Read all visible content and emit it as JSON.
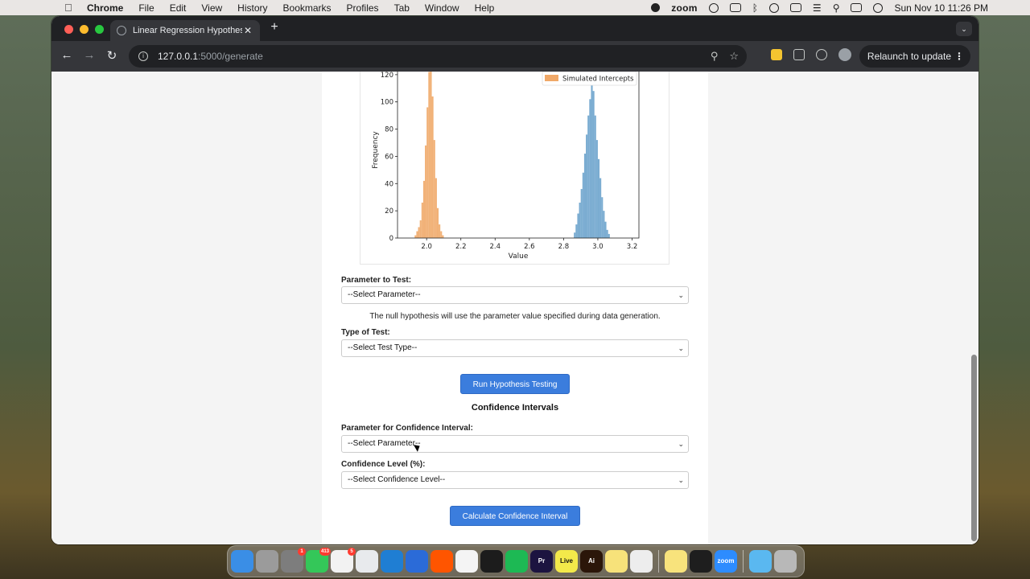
{
  "menubar": {
    "app_name": "Chrome",
    "items": [
      "File",
      "Edit",
      "View",
      "History",
      "Bookmarks",
      "Profiles",
      "Tab",
      "Window",
      "Help"
    ],
    "zoom_label": "zoom",
    "datetime": "Sun Nov 10  11:26 PM"
  },
  "browser": {
    "tab_title": "Linear Regression Hypothesis",
    "tab_close": "✕",
    "new_tab": "+",
    "url_host": "127.0.0.1",
    "url_path": ":5000/generate",
    "relaunch_label": "Relaunch to update"
  },
  "chart_data": {
    "type": "histogram",
    "xlabel": "Value",
    "ylabel": "Frequency",
    "xlim": [
      1.83,
      3.24
    ],
    "ylim": [
      0,
      127
    ],
    "xticks": [
      "2.0",
      "2.2",
      "2.4",
      "2.6",
      "2.8",
      "3.0",
      "3.2"
    ],
    "yticks": [
      "0",
      "20",
      "40",
      "60",
      "80",
      "100",
      "120"
    ],
    "legend": {
      "label": "Simulated Intercepts",
      "placement": "top-right"
    },
    "series": [
      {
        "name": "Simulated Intercepts",
        "color": "#f0a868",
        "bin_start": 1.93,
        "bin_width": 0.01,
        "values": [
          2,
          5,
          8,
          13,
          26,
          42,
          68,
          96,
          122,
          127,
          104,
          72,
          44,
          22,
          10,
          5,
          2
        ]
      },
      {
        "name": "",
        "color": "#6ba3cc",
        "bin_start": 2.86,
        "bin_width": 0.01,
        "values": [
          4,
          10,
          18,
          26,
          36,
          48,
          62,
          76,
          90,
          102,
          116,
          108,
          90,
          72,
          58,
          44,
          30,
          20,
          12,
          6,
          3
        ]
      }
    ]
  },
  "form": {
    "param_label": "Parameter to Test:",
    "param_select": "--Select Parameter--",
    "null_note": "The null hypothesis will use the parameter value specified during data generation.",
    "test_label": "Type of Test:",
    "test_select": "--Select Test Type--",
    "run_button": "Run Hypothesis Testing",
    "ci_title": "Confidence Intervals",
    "ci_param_label": "Parameter for Confidence Interval:",
    "ci_param_select": "--Select Parameter--",
    "ci_level_label": "Confidence Level (%):",
    "ci_level_select": "--Select Confidence Level--",
    "ci_button": "Calculate Confidence Interval"
  },
  "dock": {
    "apps": [
      {
        "icon": "finder-icon",
        "color": "#3a8ee6"
      },
      {
        "icon": "launchpad-icon",
        "color": "#9b9b9b"
      },
      {
        "icon": "system-settings-icon",
        "color": "#7d7d7d",
        "badge": "1"
      },
      {
        "icon": "messages-icon",
        "color": "#34c759",
        "badge": "413"
      },
      {
        "icon": "reminders-icon",
        "color": "#f2f2f2",
        "badge": "5"
      },
      {
        "icon": "chrome-icon",
        "color": "#e8eaed"
      },
      {
        "icon": "vscode-icon",
        "color": "#1f7ed3"
      },
      {
        "icon": "audio-icon",
        "color": "#2b6bd8"
      },
      {
        "icon": "soundcloud-icon",
        "color": "#ff5500"
      },
      {
        "icon": "slack-icon",
        "color": "#f4f4f4"
      },
      {
        "icon": "cursor-app-icon",
        "color": "#1c1c1c"
      },
      {
        "icon": "spotify-icon",
        "color": "#1db954"
      },
      {
        "icon": "premiere-icon",
        "color": "#1c1440",
        "text": "Pr"
      },
      {
        "icon": "ableton-live-icon",
        "color": "#f3e94a",
        "text": "Live"
      },
      {
        "icon": "illustrator-icon",
        "color": "#2b1609",
        "text": "Ai"
      },
      {
        "icon": "stickies-icon",
        "color": "#f7e27a"
      },
      {
        "icon": "activity-icon",
        "color": "#ededed"
      },
      {
        "icon": "notes-icon",
        "color": "#f8e37c"
      },
      {
        "icon": "terminal-icon",
        "color": "#1e1e1e"
      },
      {
        "icon": "zoom-icon",
        "color": "#2d8cff",
        "text": "zoom"
      },
      {
        "icon": "folder-icon",
        "color": "#5ab8f0"
      },
      {
        "icon": "trash-icon",
        "color": "#b8b8b8"
      }
    ]
  }
}
